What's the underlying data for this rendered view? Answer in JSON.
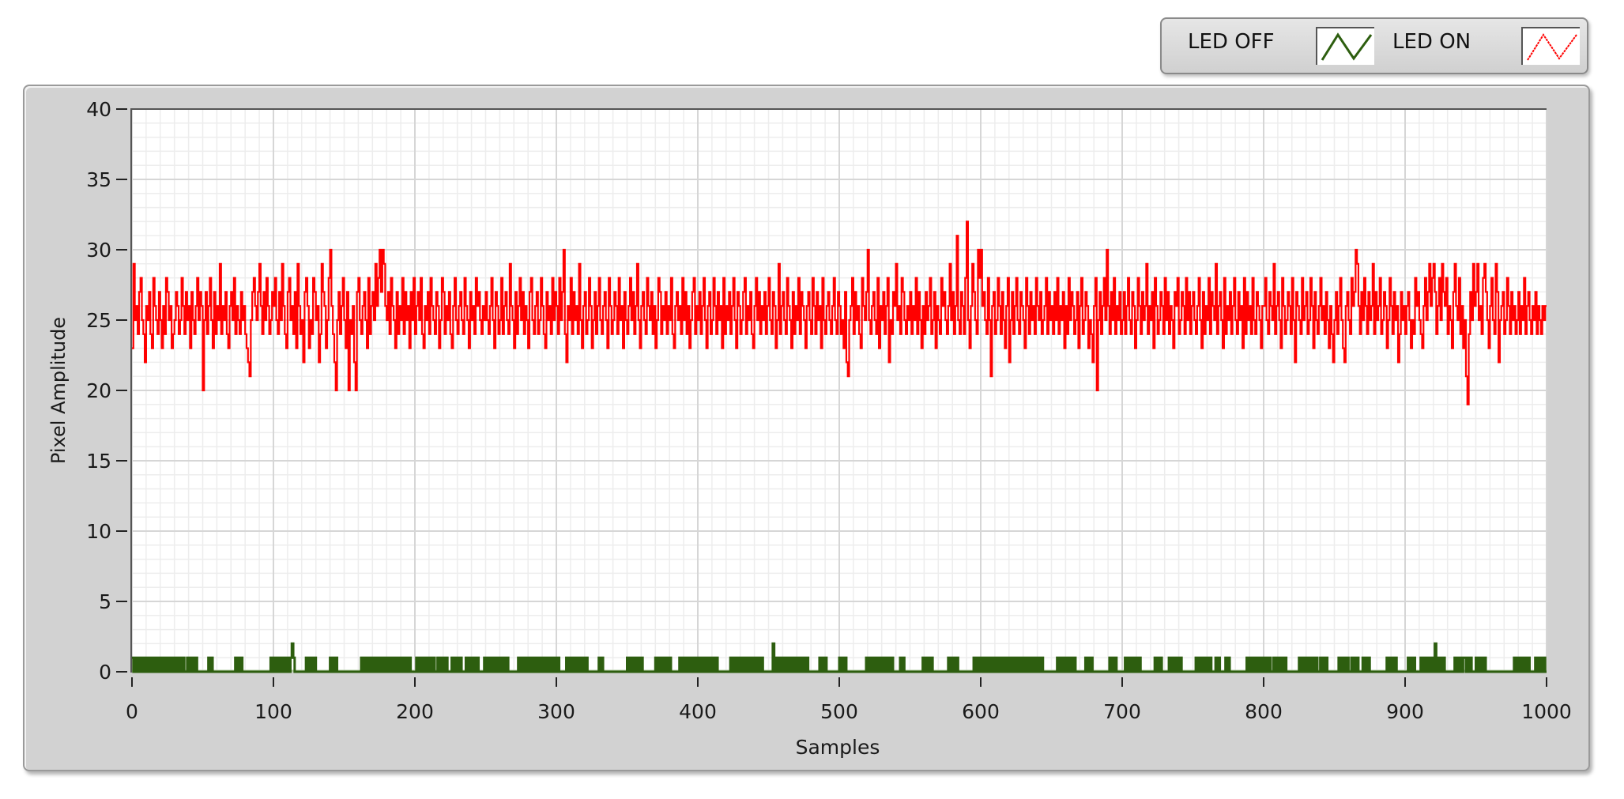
{
  "legend": {
    "items": [
      {
        "label": "LED OFF",
        "color": "#2d5e0f"
      },
      {
        "label": "LED ON",
        "color": "#ff0000"
      }
    ]
  },
  "chart_data": {
    "type": "line",
    "title": "",
    "xlabel": "Samples",
    "ylabel": "Pixel Amplitude",
    "xlim": [
      0,
      1000
    ],
    "ylim": [
      0,
      40
    ],
    "x_ticks": [
      "0",
      "100",
      "200",
      "300",
      "400",
      "500",
      "600",
      "700",
      "800",
      "900",
      "1000"
    ],
    "y_ticks": [
      "0",
      "5",
      "10",
      "15",
      "20",
      "25",
      "30",
      "35",
      "40"
    ],
    "grid": true,
    "grid_minor": {
      "x_step": 10,
      "y_step": 1
    },
    "legend_position": "top-right",
    "series": [
      {
        "name": "LED ON",
        "color": "#ff0000",
        "step": true,
        "values": [
          23,
          29,
          25,
          26,
          24,
          27,
          28,
          25,
          24,
          22,
          26,
          25,
          27,
          24,
          23,
          28,
          26,
          25,
          24,
          27,
          25,
          23,
          26,
          24,
          28,
          27,
          25,
          26,
          23,
          24,
          25,
          27,
          26,
          24,
          25,
          28,
          26,
          24,
          27,
          25,
          26,
          23,
          27,
          25,
          24,
          26,
          28,
          25,
          27,
          26,
          20,
          25,
          27,
          24,
          26,
          28,
          25,
          23,
          27,
          24,
          26,
          25,
          29,
          24,
          26,
          25,
          27,
          24,
          23,
          26,
          27,
          25,
          28,
          24,
          26,
          25,
          24,
          27,
          25,
          26,
          24,
          23,
          22,
          21,
          25,
          27,
          28,
          26,
          25,
          27,
          29,
          26,
          24,
          27,
          25,
          28,
          26,
          24,
          25,
          27,
          26,
          28,
          25,
          24,
          27,
          25,
          29,
          26,
          24,
          23,
          27,
          28,
          25,
          26,
          24,
          27,
          23,
          29,
          26,
          24,
          25,
          22,
          27,
          28,
          26,
          23,
          25,
          24,
          28,
          27,
          25,
          26,
          22,
          24,
          29,
          27,
          26,
          23,
          25,
          28,
          30,
          26,
          24,
          22,
          20,
          25,
          27,
          24,
          26,
          28,
          25,
          23,
          27,
          20,
          25,
          24,
          26,
          22,
          20,
          27,
          28,
          25,
          24,
          26,
          27,
          25,
          23,
          28,
          24,
          26,
          27,
          25,
          29,
          26,
          28,
          30,
          27,
          30,
          29,
          26,
          25,
          27,
          24,
          28,
          26,
          25,
          23,
          27,
          24,
          26,
          25,
          28,
          24,
          27,
          25,
          26,
          23,
          27,
          25,
          28,
          24,
          26,
          27,
          25,
          28,
          24,
          23,
          26,
          25,
          27,
          24,
          28,
          26,
          25,
          24,
          27,
          26,
          23,
          25,
          28,
          27,
          24,
          26,
          25,
          27,
          24,
          23,
          26,
          28,
          25,
          24,
          26,
          27,
          25,
          24,
          28,
          26,
          25,
          23,
          27,
          25,
          26,
          24,
          28,
          26,
          27,
          25,
          24,
          26,
          25,
          27,
          25,
          24,
          26,
          28,
          25,
          23,
          27,
          26,
          24,
          25,
          28,
          24,
          26,
          27,
          25,
          24,
          29,
          26,
          25,
          23,
          27,
          24,
          26,
          28,
          25,
          27,
          24,
          26,
          25,
          23,
          27,
          28,
          25,
          24,
          26,
          27,
          24,
          25,
          28,
          26,
          24,
          23,
          27,
          25,
          26,
          24,
          28,
          25,
          27,
          26,
          24,
          28,
          25,
          27,
          30,
          24,
          22,
          26,
          25,
          28,
          24,
          27,
          25,
          26,
          24,
          29,
          25,
          23,
          26,
          27,
          24,
          25,
          28,
          26,
          23,
          25,
          27,
          24,
          26,
          28,
          25,
          24,
          26,
          27,
          25,
          23,
          28,
          26,
          24,
          25,
          27,
          26,
          24,
          28,
          25,
          26,
          23,
          27,
          25,
          24,
          26,
          28,
          25,
          27,
          24,
          26,
          29,
          25,
          23,
          26,
          27,
          25,
          24,
          28,
          26,
          25,
          27,
          24,
          26,
          23,
          25,
          28,
          27,
          24,
          26,
          25,
          27,
          24,
          26,
          25,
          28,
          24,
          23,
          26,
          27,
          25,
          26,
          24,
          28,
          25,
          27,
          24,
          26,
          23,
          25,
          27,
          28,
          24,
          26,
          25,
          27,
          24,
          26,
          28,
          25,
          23,
          26,
          27,
          24,
          25,
          28,
          26,
          24,
          27,
          25,
          26,
          23,
          28,
          24,
          26,
          25,
          27,
          24,
          26,
          28,
          25,
          23,
          27,
          26,
          24,
          25,
          27,
          28,
          24,
          26,
          25,
          27,
          24,
          23,
          26,
          28,
          25,
          27,
          24,
          26,
          25,
          27,
          24,
          26,
          28,
          25,
          24,
          27,
          26,
          23,
          25,
          29,
          24,
          26,
          27,
          25,
          24,
          28,
          26,
          25,
          23,
          27,
          24,
          26,
          25,
          28,
          24,
          27,
          26,
          25,
          23,
          26,
          27,
          25,
          24,
          28,
          26,
          24,
          27,
          25,
          26,
          23,
          28,
          25,
          24,
          26,
          27,
          25,
          24,
          26,
          28,
          25,
          24,
          27,
          26,
          24,
          25,
          23,
          27,
          22,
          21,
          25,
          26,
          28,
          24,
          27,
          25,
          26,
          24,
          23,
          28,
          26,
          25,
          27,
          30,
          25,
          24,
          26,
          27,
          25,
          24,
          28,
          23,
          26,
          25,
          27,
          24,
          26,
          28,
          22,
          25,
          24,
          27,
          26,
          29,
          25,
          26,
          24,
          28,
          27,
          25,
          24,
          26,
          25,
          27,
          24,
          26,
          25,
          28,
          24,
          27,
          25,
          23,
          26,
          24,
          27,
          25,
          26,
          28,
          24,
          25,
          27,
          23,
          26,
          25,
          24,
          28,
          26,
          27,
          25,
          24,
          26,
          29,
          25,
          27,
          24,
          26,
          31,
          25,
          24,
          27,
          26,
          24,
          28,
          32,
          25,
          23,
          26,
          29,
          27,
          25,
          24,
          30,
          28,
          30,
          26,
          27,
          25,
          24,
          28,
          25,
          21,
          26,
          27,
          24,
          25,
          28,
          26,
          24,
          27,
          25,
          23,
          26,
          28,
          22,
          25,
          27,
          24,
          26,
          28,
          25,
          24,
          27,
          26,
          25,
          23,
          28,
          26,
          24,
          27,
          25,
          26,
          24,
          28,
          26,
          25,
          27,
          24,
          25,
          26,
          28,
          24,
          27,
          25,
          26,
          24,
          27,
          25,
          28,
          24,
          26,
          25,
          27,
          23,
          26,
          24,
          28,
          25,
          27,
          26,
          24,
          25,
          27,
          23,
          26,
          28,
          24,
          25,
          27,
          26,
          23,
          25,
          24,
          22,
          26,
          28,
          20,
          25,
          27,
          24,
          26,
          28,
          25,
          30,
          26,
          24,
          27,
          25,
          28,
          24,
          26,
          25,
          27,
          24,
          25,
          27,
          24,
          26,
          28,
          25,
          24,
          27,
          26,
          23,
          25,
          28,
          26,
          24,
          27,
          25,
          26,
          29,
          24,
          26,
          25,
          27,
          23,
          28,
          26,
          24,
          25,
          27,
          26,
          24,
          28,
          25,
          27,
          24,
          26,
          25,
          23,
          27,
          26,
          28,
          24,
          25,
          27,
          26,
          24,
          28,
          25,
          27,
          24,
          26,
          27,
          25,
          24,
          26,
          28,
          25,
          23,
          27,
          24,
          26,
          25,
          28,
          24,
          27,
          26,
          25,
          29,
          24,
          26,
          27,
          25,
          23,
          28,
          24,
          26,
          25,
          27,
          24,
          26,
          28,
          25,
          24,
          27,
          25,
          26,
          23,
          28,
          24,
          27,
          25,
          26,
          24,
          28,
          25,
          24,
          27,
          26,
          25,
          23,
          26,
          26,
          28,
          25,
          24,
          27,
          26,
          25,
          29,
          24,
          26,
          27,
          25,
          23,
          28,
          26,
          24,
          25,
          27,
          26,
          24,
          28,
          25,
          22,
          27,
          26,
          25,
          24,
          28,
          25,
          26,
          27,
          24,
          25,
          28,
          26,
          23,
          27,
          25,
          24,
          26,
          28,
          25,
          26,
          24,
          27,
          25,
          23,
          26,
          24,
          22,
          25,
          27,
          24,
          26,
          28,
          25,
          23,
          22,
          26,
          27,
          25,
          24,
          28,
          26,
          27,
          30,
          29,
          26,
          24,
          27,
          25,
          28,
          26,
          24,
          27,
          25,
          26,
          29,
          24,
          27,
          25,
          26,
          28,
          24,
          25,
          27,
          26,
          23,
          25,
          28,
          26,
          24,
          27,
          25,
          26,
          22,
          24,
          27,
          25,
          26,
          24,
          26,
          27,
          25,
          23,
          25,
          24,
          28,
          26,
          27,
          25,
          24,
          23,
          26,
          28,
          25,
          27,
          29,
          26,
          28,
          29,
          27,
          24,
          26,
          28,
          25,
          29,
          27,
          26,
          28,
          24,
          26,
          25,
          23,
          27,
          29,
          26,
          25,
          28,
          24,
          26,
          23,
          25,
          21,
          19,
          24,
          27,
          25,
          29,
          26,
          27,
          29,
          25,
          26,
          24,
          28,
          29,
          27,
          25,
          23,
          26,
          28,
          25,
          24,
          29,
          27,
          22,
          25,
          26,
          27,
          24,
          25,
          28,
          26,
          24,
          27,
          25,
          26,
          24,
          25,
          27,
          24,
          26,
          25,
          28,
          24,
          26,
          27,
          25,
          24,
          26,
          25,
          27,
          24,
          26,
          25,
          24,
          26,
          25,
          26
        ]
      },
      {
        "name": "LED OFF",
        "color": "#2d5e0f",
        "step": true,
        "length": 1000,
        "baseline_value": 0,
        "alternating_0_1_ranges": [
          [
            0,
            36
          ],
          [
            39,
            45
          ],
          [
            54,
            57
          ],
          [
            73,
            77
          ],
          [
            98,
            115
          ],
          [
            123,
            129
          ],
          [
            140,
            145
          ],
          [
            162,
            196
          ],
          [
            201,
            213
          ],
          [
            216,
            222
          ],
          [
            226,
            233
          ],
          [
            236,
            244
          ],
          [
            249,
            266
          ],
          [
            273,
            302
          ],
          [
            307,
            322
          ],
          [
            330,
            333
          ],
          [
            350,
            361
          ],
          [
            370,
            380
          ],
          [
            387,
            407
          ],
          [
            409,
            414
          ],
          [
            423,
            445
          ],
          [
            453,
            465
          ],
          [
            467,
            478
          ],
          [
            486,
            490
          ],
          [
            500,
            505
          ],
          [
            519,
            537
          ],
          [
            543,
            545
          ],
          [
            559,
            565
          ],
          [
            577,
            583
          ],
          [
            595,
            643
          ],
          [
            654,
            667
          ],
          [
            674,
            678
          ],
          [
            691,
            695
          ],
          [
            702,
            713
          ],
          [
            723,
            727
          ],
          [
            733,
            741
          ],
          [
            752,
            762
          ],
          [
            766,
            769
          ],
          [
            773,
            775
          ],
          [
            788,
            805
          ],
          [
            807,
            815
          ],
          [
            825,
            837
          ],
          [
            840,
            844
          ],
          [
            853,
            859
          ],
          [
            862,
            866
          ],
          [
            870,
            874
          ],
          [
            887,
            894
          ],
          [
            902,
            906
          ],
          [
            911,
            927
          ],
          [
            935,
            941
          ],
          [
            942,
            946
          ],
          [
            950,
            956
          ],
          [
            977,
            988
          ],
          [
            992,
            998
          ]
        ],
        "peaks": [
          [
            113,
            2
          ],
          [
            453,
            2
          ],
          [
            921,
            2
          ]
        ]
      }
    ]
  }
}
